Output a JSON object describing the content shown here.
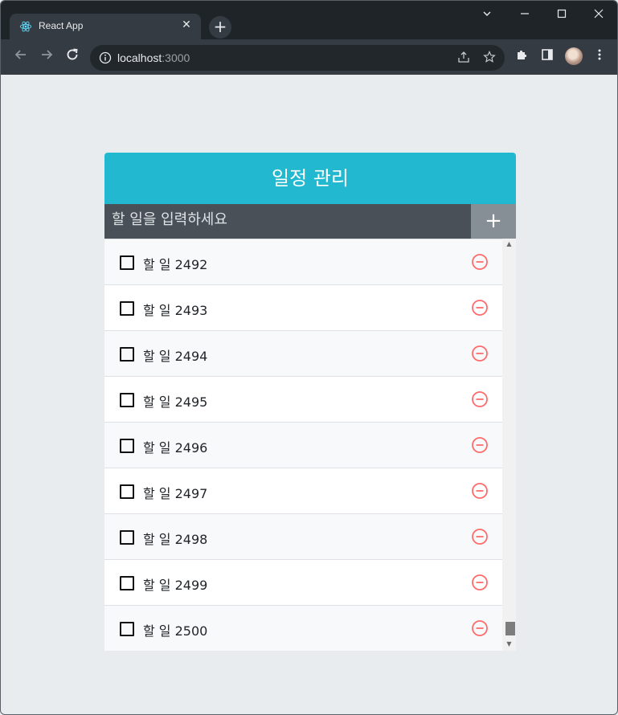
{
  "browser": {
    "tab_title": "React App",
    "url_host": "localhost",
    "url_port": ":3000"
  },
  "app": {
    "title": "일정 관리",
    "input_placeholder": "할 일을 입력하세요",
    "add_label": "+"
  },
  "todos": [
    {
      "text": "할 일 2492",
      "checked": false
    },
    {
      "text": "할 일 2493",
      "checked": false
    },
    {
      "text": "할 일 2494",
      "checked": false
    },
    {
      "text": "할 일 2495",
      "checked": false
    },
    {
      "text": "할 일 2496",
      "checked": false
    },
    {
      "text": "할 일 2497",
      "checked": false
    },
    {
      "text": "할 일 2498",
      "checked": false
    },
    {
      "text": "할 일 2499",
      "checked": false
    },
    {
      "text": "할 일 2500",
      "checked": false
    }
  ],
  "colors": {
    "header": "#22b8cf",
    "input_bg": "#495057",
    "add_button": "#868e96",
    "remove_icon": "#ff6b6b"
  },
  "icons": {
    "checkbox": "checkbox-blank-icon",
    "remove": "minus-circle-icon"
  }
}
